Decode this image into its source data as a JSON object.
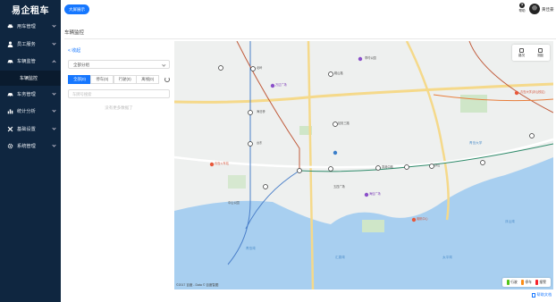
{
  "app": {
    "logo": "易企租车"
  },
  "colors": {
    "sidebar": "#0f2640",
    "accent": "#1677ff",
    "idle": "#52c41a",
    "offline": "#fa8c16",
    "alarm": "#f5222d"
  },
  "sidebar": {
    "items": [
      {
        "label": "用车管理",
        "icon": "car-icon",
        "expanded": false
      },
      {
        "label": "员工服务",
        "icon": "user-icon",
        "expanded": false
      },
      {
        "label": "车辆监管",
        "icon": "vehicle-icon",
        "expanded": true
      },
      {
        "label": "车务管理",
        "icon": "car-service-icon",
        "expanded": false
      },
      {
        "label": "统计分析",
        "icon": "chart-icon",
        "expanded": false
      },
      {
        "label": "基础设置",
        "icon": "tools-icon",
        "expanded": false
      },
      {
        "label": "系统管理",
        "icon": "gear-icon",
        "expanded": false
      }
    ],
    "sub_active": "车辆监控"
  },
  "topbar": {
    "big_screen": "大屏展示",
    "help": "帮助",
    "username": "黄佳豪"
  },
  "page": {
    "title": "车辆监控"
  },
  "panel": {
    "collapse": "< 收起",
    "group_select": "全部分组",
    "tabs": [
      {
        "label": "全部(0)",
        "active": true
      },
      {
        "label": "停车(0)",
        "active": false
      },
      {
        "label": "行驶(0)",
        "active": false
      },
      {
        "label": "离线(0)",
        "active": false
      }
    ],
    "search_placeholder": "车牌号搜索",
    "empty": "没有更多数据了"
  },
  "map": {
    "tools": [
      "路况",
      "测距"
    ],
    "copyright": "©2017 百度 - Data © 百度智图",
    "legend": [
      {
        "label": "行驶",
        "color": "#52c41a"
      },
      {
        "label": "停车",
        "color": "#fa8c16"
      },
      {
        "label": "报警",
        "color": "#f5222d"
      }
    ],
    "labels": {
      "l1": "万达广场",
      "l2": "李村公园",
      "l3": "青岛大学",
      "l4": "海信广场",
      "l5": "中山公园",
      "l6": "奥帆中心",
      "l7": "五四广场",
      "l8": "台东",
      "l9": "延安三路",
      "l10": "香港中路",
      "l11": "浮山",
      "l12": "青岛火车站",
      "l13": "北岭",
      "l14": "海泊桥",
      "l15": "鞍山路",
      "l16": "青岛湾",
      "l17": "太平湾",
      "l18": "浮山湾",
      "l19": "汇泉湾",
      "l20": "青岛大学(浮山校区)"
    }
  },
  "footer": {
    "doc": "帮助文档"
  }
}
